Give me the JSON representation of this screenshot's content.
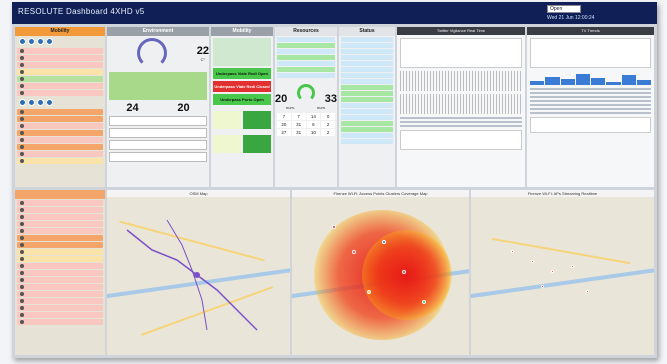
{
  "header": {
    "title": "RESOLUTE Dashboard 4XHD v5",
    "select_value": "Open",
    "datetime": "Wed 21 Jun 12:00:24"
  },
  "columns": {
    "col1_title": "Mobility",
    "col2_title": "Environment",
    "col3_title": "Mobility",
    "col4_title": "Resources",
    "col5_title": "Status",
    "col6_title": "Twitter Vigilance Real Time",
    "col7_title": "TV Trends"
  },
  "env": {
    "gauge1": "22",
    "gauge2": "24",
    "gauge3": "20",
    "unit": "C°"
  },
  "mobility_blocks": [
    "Underpass Viale Redi Open",
    "Underpass Viale Redi Closed",
    "Underpass Porto Open"
  ],
  "resources": {
    "left": "20",
    "right": "33",
    "label": "num."
  },
  "grid_vals": [
    "7",
    "7",
    "14",
    "0",
    "20",
    "31",
    "6",
    "2",
    "27",
    "31",
    "10",
    "2"
  ],
  "maps": {
    "m1": "OSM Map",
    "m2": "Firenze Wi-Fi: Access Points Clusters Coverage Map",
    "m3": "Firenze Wi-Fi: APs Streaming Realtime"
  }
}
